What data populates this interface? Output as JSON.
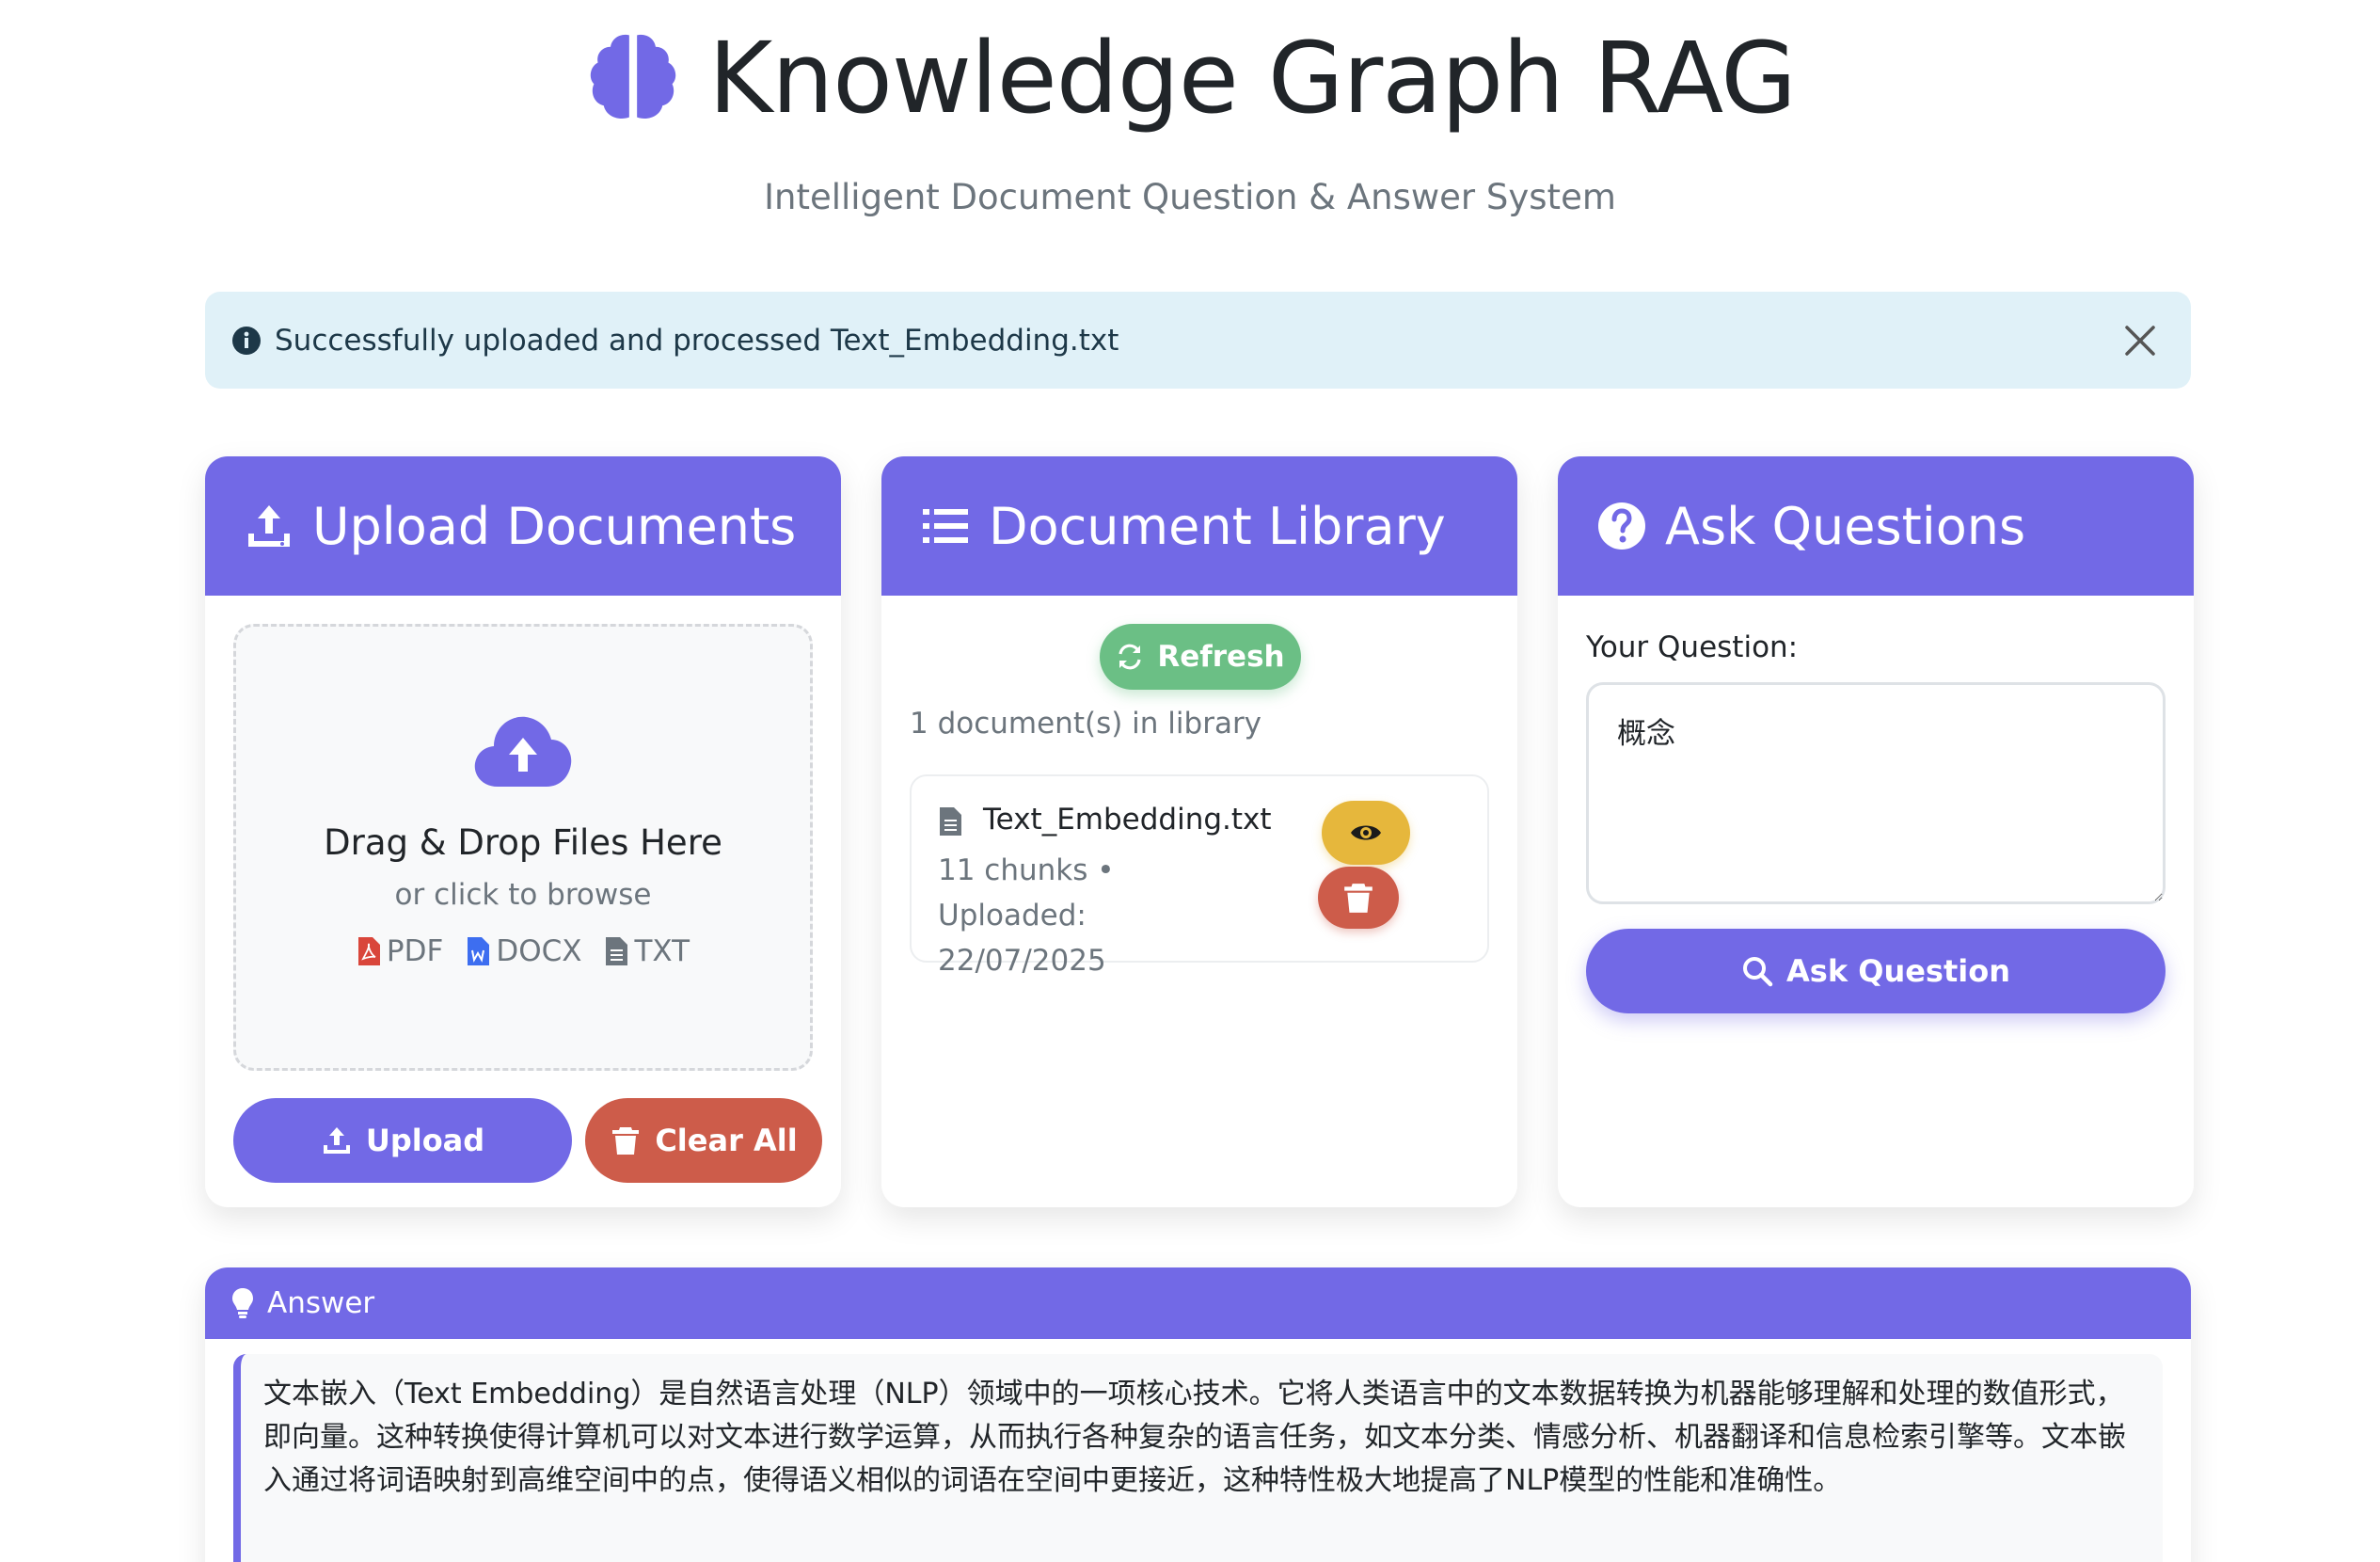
{
  "header": {
    "title": "Knowledge Graph RAG",
    "subtitle": "Intelligent Document Question & Answer System"
  },
  "alert": {
    "message": "Successfully uploaded and processed Text_Embedding.txt"
  },
  "upload": {
    "title": "Upload Documents",
    "dropzone_title": "Drag & Drop Files Here",
    "dropzone_subtitle": "or click to browse",
    "formats": [
      "PDF",
      "DOCX",
      "TXT"
    ],
    "upload_label": "Upload",
    "clear_label": "Clear All"
  },
  "library": {
    "title": "Document Library",
    "refresh_label": "Refresh",
    "count_text": "1 document(s) in library",
    "documents": [
      {
        "name": "Text_Embedding.txt",
        "meta": "11 chunks • Uploaded: 22/07/2025"
      }
    ]
  },
  "ask": {
    "title": "Ask Questions",
    "question_label": "Your Question:",
    "question_value": "概念",
    "ask_label": "Ask Question"
  },
  "answer": {
    "title": "Answer",
    "text": "文本嵌入（Text Embedding）是自然语言处理（NLP）领域中的一项核心技术。它将人类语言中的文本数据转换为机器能够理解和处理的数值形式，即向量。这种转换使得计算机可以对文本进行数学运算，从而执行各种复杂的语言任务，如文本分类、情感分析、机器翻译和信息检索引擎等。文本嵌入通过将词语映射到高维空间中的点，使得语义相似的词语在空间中更接近，这种特性极大地提高了NLP模型的性能和准确性。"
  },
  "colors": {
    "primary": "#7269e6",
    "success": "#6bbf85",
    "warning": "#e6b73c",
    "danger": "#cd5c4a",
    "info_bg": "#e0f1f8"
  },
  "icons": {
    "brand": "brain-icon",
    "upload_header": "upload-icon",
    "library_header": "list-icon",
    "ask_header": "question-circle-icon",
    "answer_header": "lightbulb-icon"
  }
}
